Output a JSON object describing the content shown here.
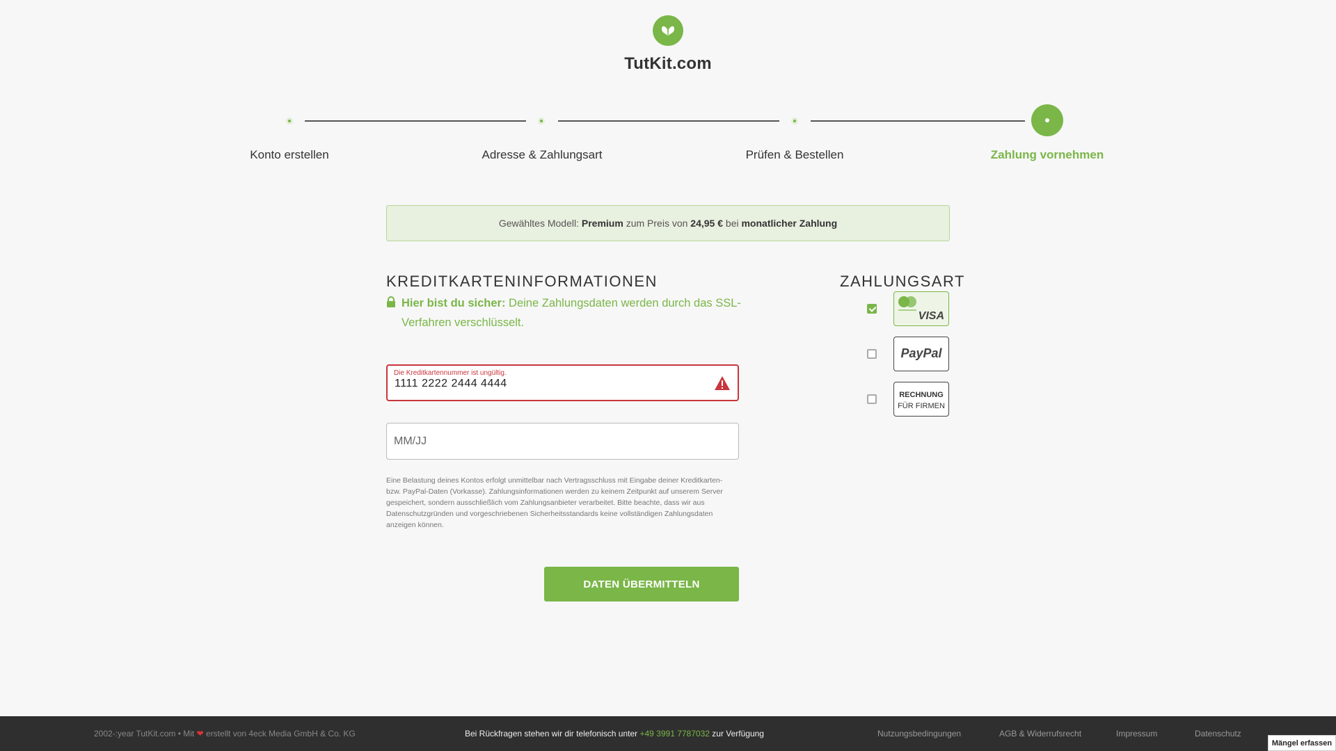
{
  "brand": {
    "name": "TutKit.com",
    "accent": "#7ab648"
  },
  "stepper": {
    "steps": [
      {
        "label": "Konto erstellen",
        "state": "done"
      },
      {
        "label": "Adresse & Zahlungsart",
        "state": "done"
      },
      {
        "label": "Prüfen & Bestellen",
        "state": "done"
      },
      {
        "label": "Zahlung vornehmen",
        "state": "active"
      }
    ]
  },
  "banner": {
    "prefix": "Gewähltes Modell:",
    "model": "Premium",
    "mid": "zum Preis von",
    "price": "24,95 €",
    "mid2": "bei",
    "billing": "monatlicher Zahlung"
  },
  "card_section": {
    "heading": "KREDITKARTENINFORMATIONEN",
    "secure_strong": "Hier bist du sicher:",
    "secure_text": "Deine Zahlungsdaten werden durch das SSL-Verfahren verschlüsselt.",
    "card_number": {
      "error": "Die Kreditkartennummer ist ungültig.",
      "value": "1111 2222 2444 4444"
    },
    "expiry": {
      "placeholder": "MM/JJ",
      "value": ""
    },
    "disclaimer": "Eine Belastung deines Kontos erfolgt unmittelbar nach Vertragsschluss mit Eingabe deiner Kreditkarten- bzw. PayPal-Daten (Vorkasse). Zahlungsinformationen werden zu keinem Zeitpunkt auf unserem Server gespeichert, sondern ausschließlich vom Zahlungsanbieter verarbeitet. Bitte beachte, dass wir aus Datenschutzgründen und vorgeschriebenen Sicherheitsstandards keine vollständigen Zahlungsdaten anzeigen können.",
    "submit": "DATEN ÜBERMITTELN"
  },
  "payment_section": {
    "heading": "ZAHLUNGSART",
    "options": [
      {
        "name": "creditcard",
        "label": "VISA",
        "checked": true
      },
      {
        "name": "paypal",
        "label": "PayPal",
        "checked": false
      },
      {
        "name": "invoice",
        "label_line1": "RECHNUNG",
        "label_line2": "FÜR FIRMEN",
        "checked": false
      }
    ]
  },
  "footer": {
    "copyright_a": "2002-:year TutKit.com • Mit",
    "copyright_b": "erstellt von 4eck Media GmbH & Co. KG",
    "contact_a": "Bei Rückfragen stehen wir dir telefonisch unter",
    "phone": "+49 3991 7787032",
    "contact_b": "zur Verfügung",
    "links": [
      "Nutzungsbedingungen",
      "AGB & Widerrufsrecht",
      "Impressum",
      "Datenschutz"
    ],
    "feedback_button": "Mängel erfassen"
  }
}
